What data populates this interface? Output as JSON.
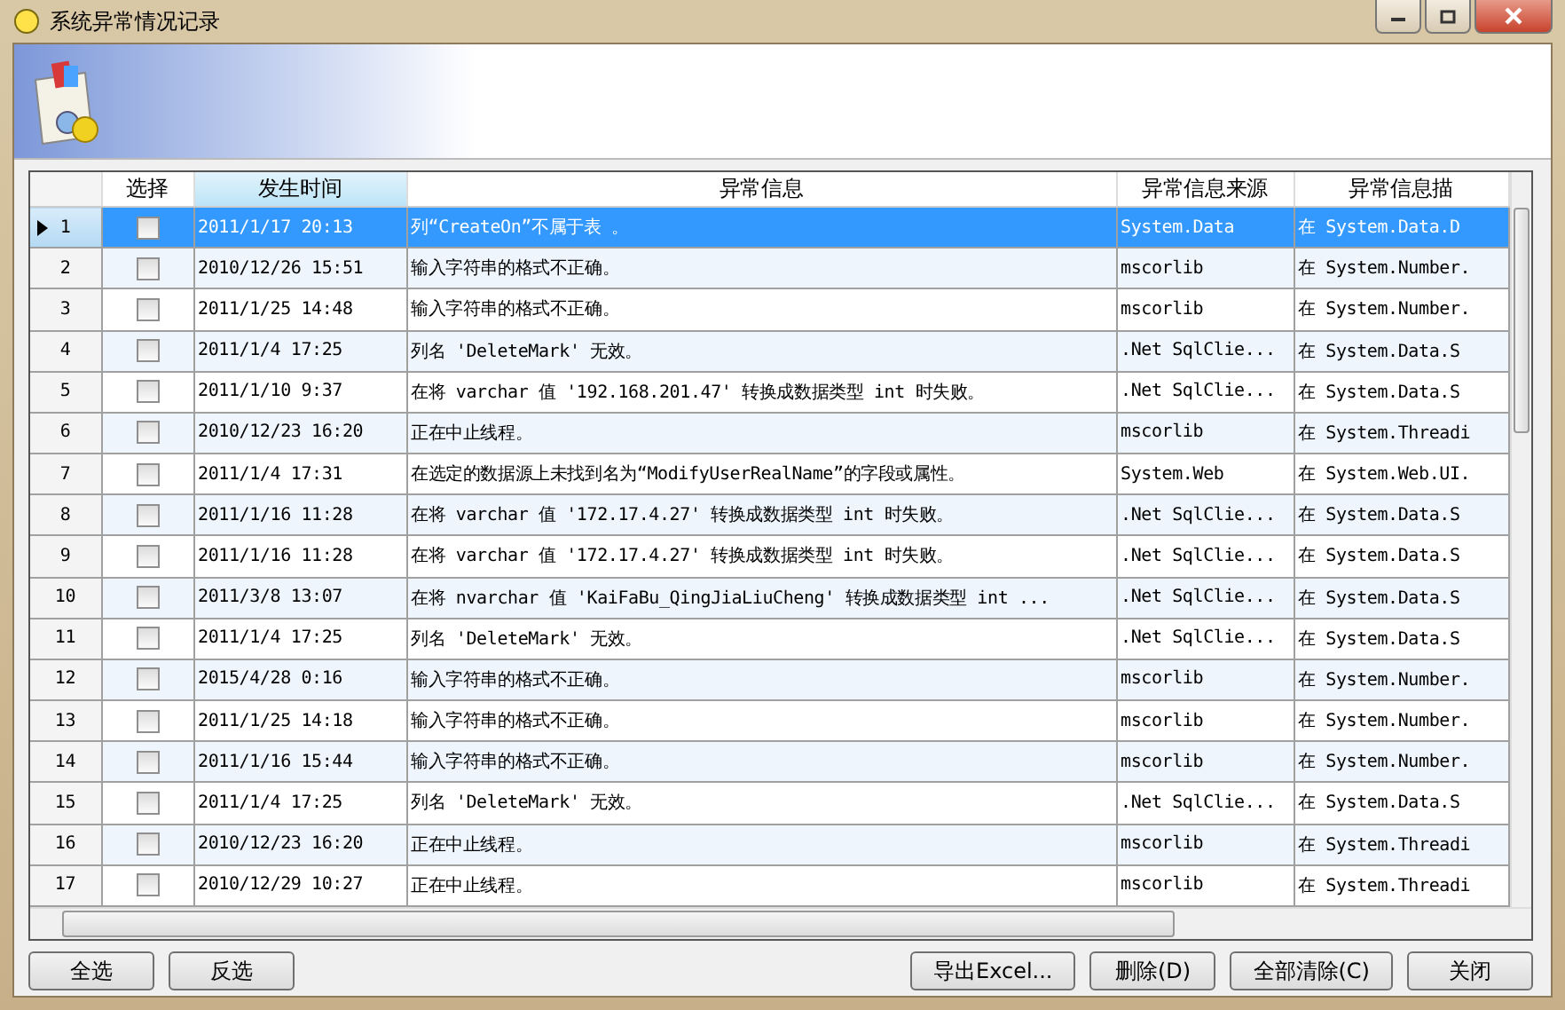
{
  "window": {
    "title": "系统异常情况记录"
  },
  "table": {
    "columns": [
      {
        "label": "选择",
        "sorted": false
      },
      {
        "label": "发生时间",
        "sorted": true
      },
      {
        "label": "异常信息",
        "sorted": false
      },
      {
        "label": "异常信息来源",
        "sorted": false
      },
      {
        "label": "异常信息描",
        "sorted": false
      }
    ],
    "rows": [
      {
        "index": "1",
        "selected": true,
        "checked": false,
        "time": "2011/1/17 20:13",
        "message": "列“CreateOn”不属于表 。",
        "source": "System.Data",
        "description": "在 System.Data.D"
      },
      {
        "index": "2",
        "selected": false,
        "checked": false,
        "time": "2010/12/26 15:51",
        "message": "输入字符串的格式不正确。",
        "source": "mscorlib",
        "description": "在 System.Number."
      },
      {
        "index": "3",
        "selected": false,
        "checked": false,
        "time": "2011/1/25 14:48",
        "message": "输入字符串的格式不正确。",
        "source": "mscorlib",
        "description": "在 System.Number."
      },
      {
        "index": "4",
        "selected": false,
        "checked": false,
        "time": "2011/1/4 17:25",
        "message": "列名 'DeleteMark' 无效。",
        "source": ".Net SqlClie...",
        "description": "在 System.Data.S"
      },
      {
        "index": "5",
        "selected": false,
        "checked": false,
        "time": "2011/1/10 9:37",
        "message": "在将 varchar 值 '192.168.201.47' 转换成数据类型 int 时失败。",
        "source": ".Net SqlClie...",
        "description": "在 System.Data.S"
      },
      {
        "index": "6",
        "selected": false,
        "checked": false,
        "time": "2010/12/23 16:20",
        "message": "正在中止线程。",
        "source": "mscorlib",
        "description": "在 System.Threadi"
      },
      {
        "index": "7",
        "selected": false,
        "checked": false,
        "time": "2011/1/4 17:31",
        "message": "在选定的数据源上未找到名为“ModifyUserRealName”的字段或属性。",
        "source": "System.Web",
        "description": "在 System.Web.UI."
      },
      {
        "index": "8",
        "selected": false,
        "checked": false,
        "time": "2011/1/16 11:28",
        "message": "在将 varchar 值 '172.17.4.27' 转换成数据类型 int 时失败。",
        "source": ".Net SqlClie...",
        "description": "在 System.Data.S"
      },
      {
        "index": "9",
        "selected": false,
        "checked": false,
        "time": "2011/1/16 11:28",
        "message": "在将 varchar 值 '172.17.4.27' 转换成数据类型 int 时失败。",
        "source": ".Net SqlClie...",
        "description": "在 System.Data.S"
      },
      {
        "index": "10",
        "selected": false,
        "checked": false,
        "time": "2011/3/8 13:07",
        "message": "在将 nvarchar 值 'KaiFaBu_QingJiaLiuCheng' 转换成数据类型 int ...",
        "source": ".Net SqlClie...",
        "description": "在 System.Data.S"
      },
      {
        "index": "11",
        "selected": false,
        "checked": false,
        "time": "2011/1/4 17:25",
        "message": "列名 'DeleteMark' 无效。",
        "source": ".Net SqlClie...",
        "description": "在 System.Data.S"
      },
      {
        "index": "12",
        "selected": false,
        "checked": false,
        "time": "2015/4/28 0:16",
        "message": "输入字符串的格式不正确。",
        "source": "mscorlib",
        "description": "在 System.Number."
      },
      {
        "index": "13",
        "selected": false,
        "checked": false,
        "time": "2011/1/25 14:18",
        "message": "输入字符串的格式不正确。",
        "source": "mscorlib",
        "description": "在 System.Number."
      },
      {
        "index": "14",
        "selected": false,
        "checked": false,
        "time": "2011/1/16 15:44",
        "message": "输入字符串的格式不正确。",
        "source": "mscorlib",
        "description": "在 System.Number."
      },
      {
        "index": "15",
        "selected": false,
        "checked": false,
        "time": "2011/1/4 17:25",
        "message": "列名 'DeleteMark' 无效。",
        "source": ".Net SqlClie...",
        "description": "在 System.Data.S"
      },
      {
        "index": "16",
        "selected": false,
        "checked": false,
        "time": "2010/12/23 16:20",
        "message": "正在中止线程。",
        "source": "mscorlib",
        "description": "在 System.Threadi"
      },
      {
        "index": "17",
        "selected": false,
        "checked": false,
        "time": "2010/12/29 10:27",
        "message": "正在中止线程。",
        "source": "mscorlib",
        "description": "在 System.Threadi"
      }
    ]
  },
  "left_buttons": [
    "全选",
    "反选"
  ],
  "right_buttons": [
    "导出Excel...",
    "删除(D)",
    "全部清除(C)",
    "关闭"
  ]
}
